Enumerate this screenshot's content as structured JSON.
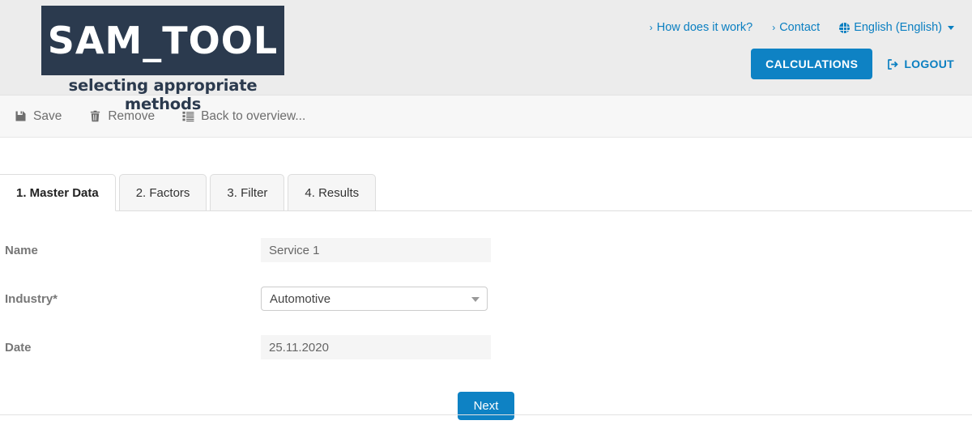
{
  "header": {
    "logo": {
      "title": "SAM_TOOL",
      "tagline": "selecting appropriate methods",
      "box_color": "#2b3a4e"
    },
    "links": [
      {
        "label": "How does it work?",
        "icon": "chevron-right-icon"
      },
      {
        "label": "Contact",
        "icon": "chevron-right-icon"
      }
    ],
    "language": {
      "label": "English (English)",
      "icon": "globe-icon",
      "caret": "chevron-down-icon"
    },
    "calculations_button": "CALCULATIONS",
    "logout": {
      "label": "LOGOUT",
      "icon": "sign-out-icon"
    },
    "accent_color": "#0e82c4",
    "link_color": "#0a7fc1",
    "background": "#ececec"
  },
  "toolbar": {
    "items": [
      {
        "label": "Save",
        "icon": "floppy-disk-icon"
      },
      {
        "label": "Remove",
        "icon": "trash-icon"
      },
      {
        "label": "Back to overview...",
        "icon": "list-icon"
      }
    ]
  },
  "tabs": [
    {
      "label": "1. Master Data",
      "active": true
    },
    {
      "label": "2. Factors",
      "active": false
    },
    {
      "label": "3. Filter",
      "active": false
    },
    {
      "label": "4. Results",
      "active": false
    }
  ],
  "form": {
    "rows": [
      {
        "label": "Name",
        "type": "readonly",
        "value": "Service 1"
      },
      {
        "label": "Industry*",
        "type": "select",
        "value": "Automotive"
      },
      {
        "label": "Date",
        "type": "readonly",
        "value": "25.11.2020"
      }
    ],
    "next_button": "Next"
  }
}
